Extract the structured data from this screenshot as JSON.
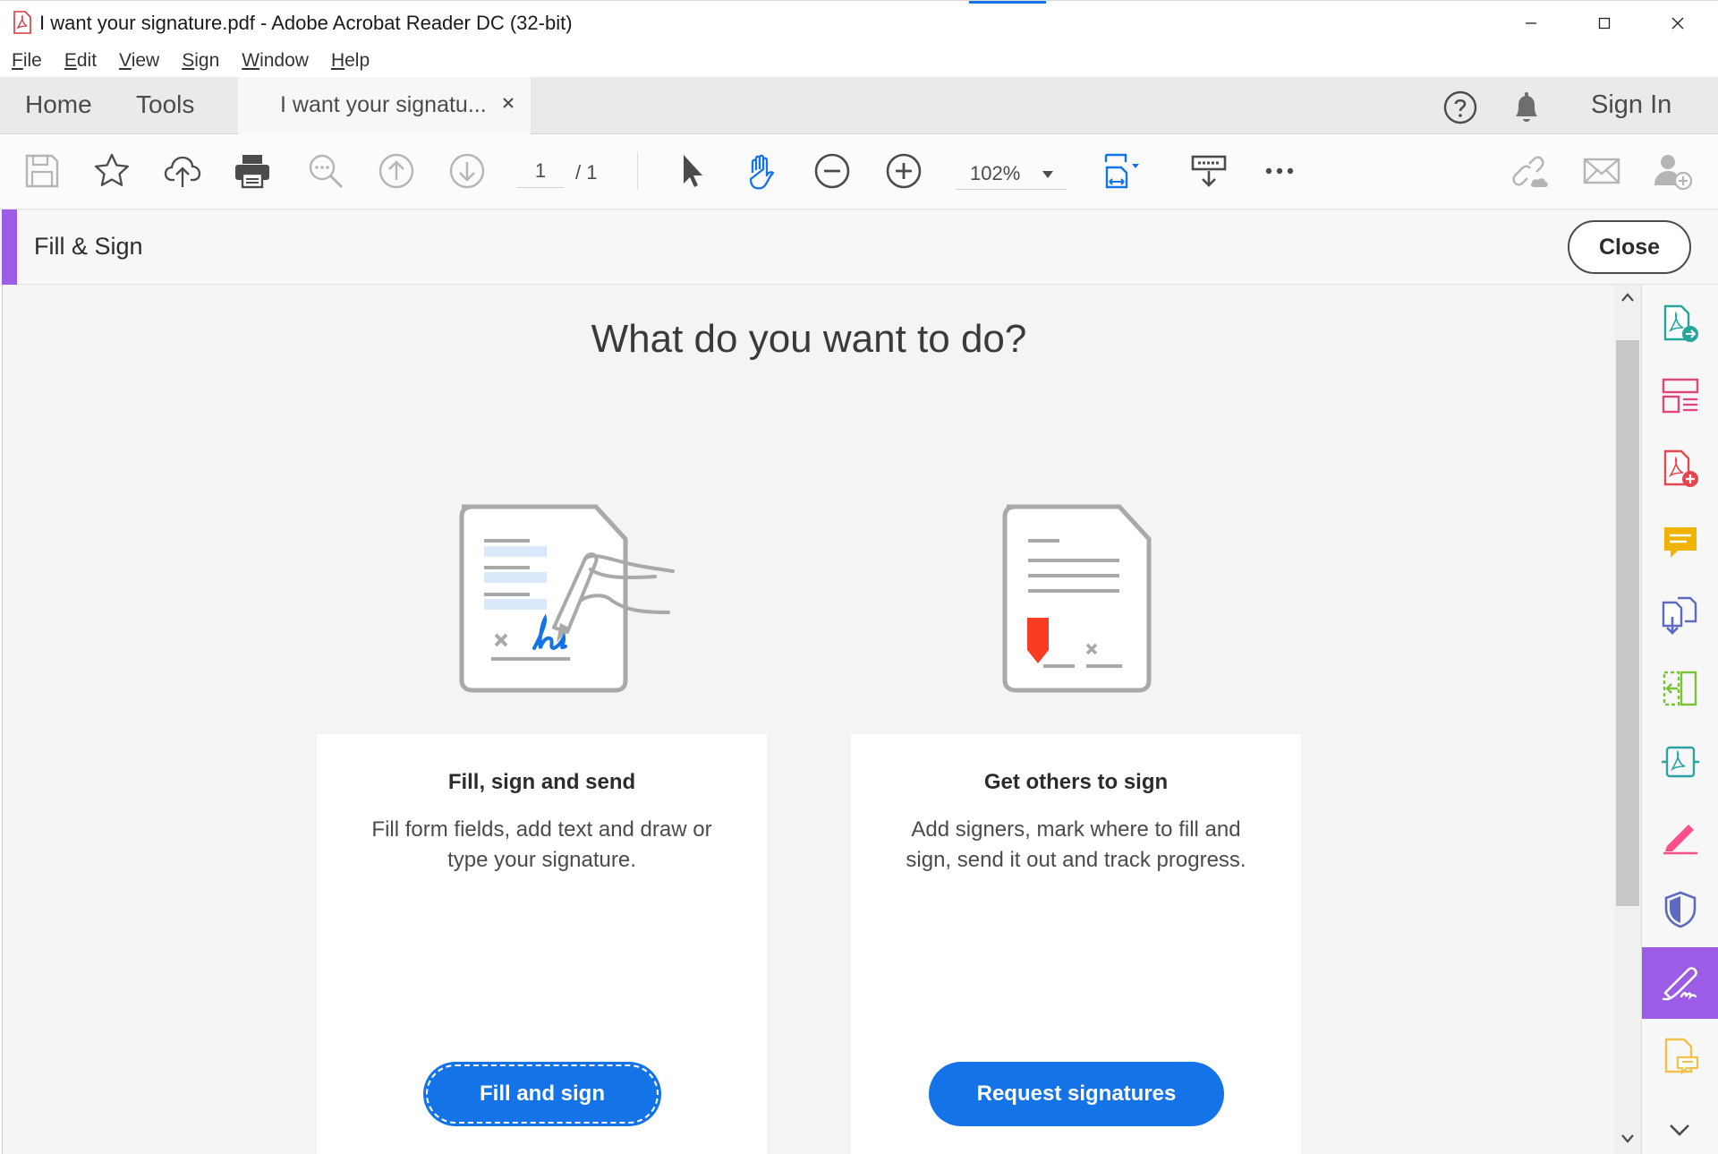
{
  "window": {
    "title": "I want your signature.pdf - Adobe Acrobat Reader DC (32-bit)"
  },
  "menu": {
    "items": [
      {
        "underline": "F",
        "rest": "ile"
      },
      {
        "underline": "E",
        "rest": "dit"
      },
      {
        "underline": "V",
        "rest": "iew"
      },
      {
        "underline": "S",
        "rest": "ign"
      },
      {
        "underline": "W",
        "rest": "indow"
      },
      {
        "underline": "H",
        "rest": "elp"
      }
    ]
  },
  "tabs": {
    "home": "Home",
    "tools": "Tools",
    "document": "I want your signatu...",
    "sign_in": "Sign In"
  },
  "toolbar": {
    "current_page": "1",
    "page_total": "/ 1",
    "zoom": "102%"
  },
  "tool_panel": {
    "title": "Fill & Sign",
    "close_label": "Close",
    "accent_color": "#9d5ce6"
  },
  "main": {
    "heading": "What do you want to do?",
    "cards": [
      {
        "title": "Fill, sign and send",
        "description": "Fill form fields, add text and draw or type your signature.",
        "button": "Fill and sign"
      },
      {
        "title": "Get others to sign",
        "description": "Add signers, mark where to fill and sign, send it out and track progress.",
        "button": "Request signatures"
      }
    ]
  },
  "colors": {
    "primary_button": "#1473e6",
    "active_tool": "#9d5ce6"
  },
  "right_panel": {
    "icons": [
      "export-pdf-icon",
      "organize-pages-icon",
      "create-pdf-icon",
      "comment-icon",
      "combine-files-icon",
      "compress-pdf-icon",
      "send-for-review-icon",
      "edit-pdf-icon",
      "protect-icon",
      "fill-sign-icon",
      "scan-icon"
    ]
  }
}
